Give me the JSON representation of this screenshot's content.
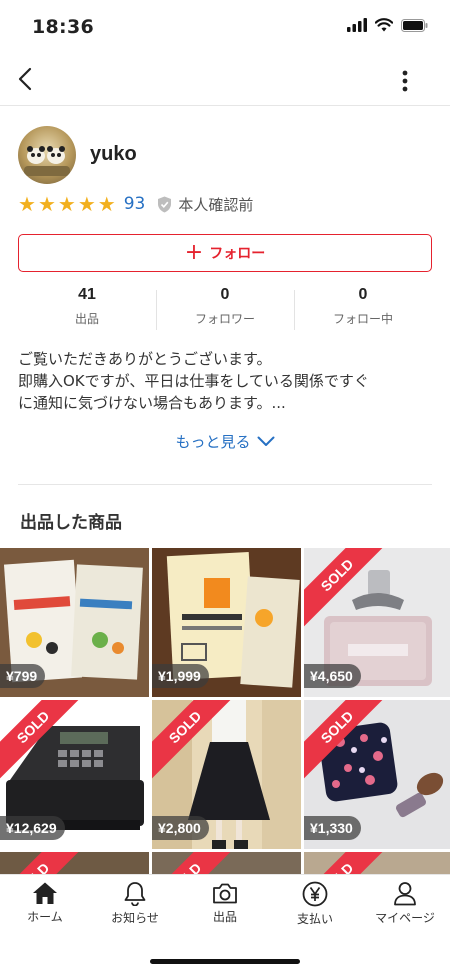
{
  "status": {
    "time": "18:36"
  },
  "profile": {
    "username": "yuko",
    "rating_count": "93",
    "verification": "本人確認前",
    "follow_label": "フォロー"
  },
  "stats": [
    {
      "value": "41",
      "label": "出品"
    },
    {
      "value": "0",
      "label": "フォロワー"
    },
    {
      "value": "0",
      "label": "フォロー中"
    }
  ],
  "bio": {
    "line1": "ご覧いただきありがとうございます。",
    "line2": "即購入OKですが、平日は仕事をしている関係ですぐ",
    "line3": "に通知に気づけない場合もあります。...",
    "more": "もっと見る"
  },
  "section_title": "出品した商品",
  "items": [
    {
      "price": "¥799",
      "sold": false
    },
    {
      "price": "¥1,999",
      "sold": false
    },
    {
      "price": "¥4,650",
      "sold": true
    },
    {
      "price": "¥12,629",
      "sold": true
    },
    {
      "price": "¥2,800",
      "sold": true
    },
    {
      "price": "¥1,330",
      "sold": true
    }
  ],
  "sold_label": "SOLD",
  "tabs": [
    {
      "label": "ホーム",
      "icon": "home-icon"
    },
    {
      "label": "お知らせ",
      "icon": "bell-icon"
    },
    {
      "label": "出品",
      "icon": "camera-icon"
    },
    {
      "label": "支払い",
      "icon": "yen-icon"
    },
    {
      "label": "マイページ",
      "icon": "person-icon"
    }
  ],
  "colors": {
    "accent": "#e5222e",
    "link": "#2670c3",
    "star": "#f2b01e",
    "sold": "#ea3545"
  }
}
